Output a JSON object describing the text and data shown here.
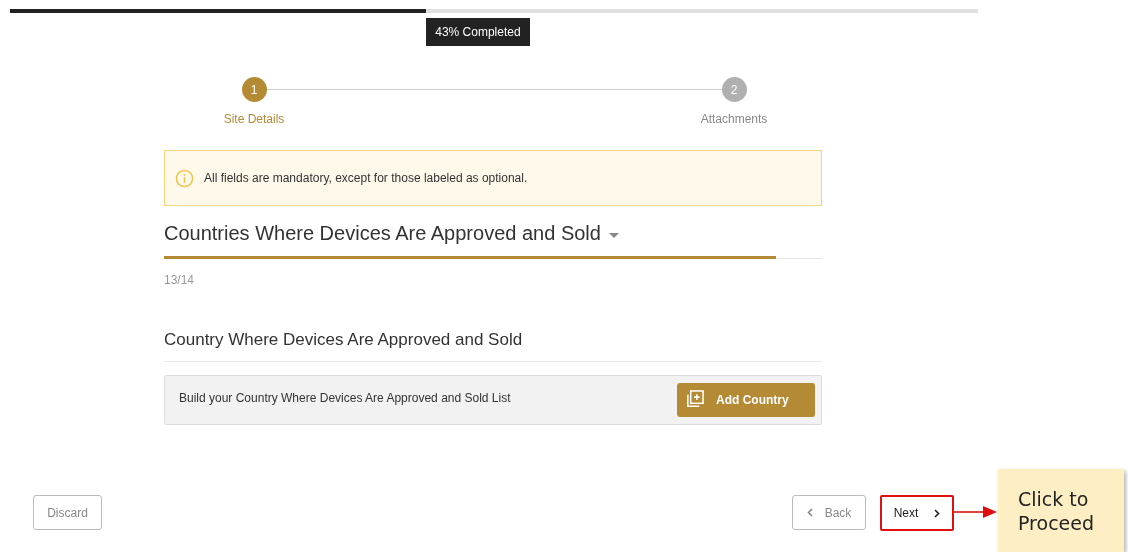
{
  "progress": {
    "level": 0.43,
    "label": "43% Completed"
  },
  "steps": [
    {
      "number": "1",
      "label": "Site Details",
      "selected": true
    },
    {
      "number": "2",
      "label": "Attachments",
      "selected": false
    }
  ],
  "notice": "All fields are mandatory, except for those labeled as optional.",
  "section": {
    "title": "Countries Where Devices Are Approved and Sold",
    "level": 0.93,
    "count": "13/14"
  },
  "subsection": {
    "title": "Country Where Devices Are Approved and Sold",
    "hint": "Build your Country Where Devices Are Approved and Sold List",
    "button": "Add Country"
  },
  "footer": {
    "discard": "Discard",
    "back": "Back",
    "next": "Next",
    "next_highlighted": true
  },
  "callout": "Click to Proceed"
}
